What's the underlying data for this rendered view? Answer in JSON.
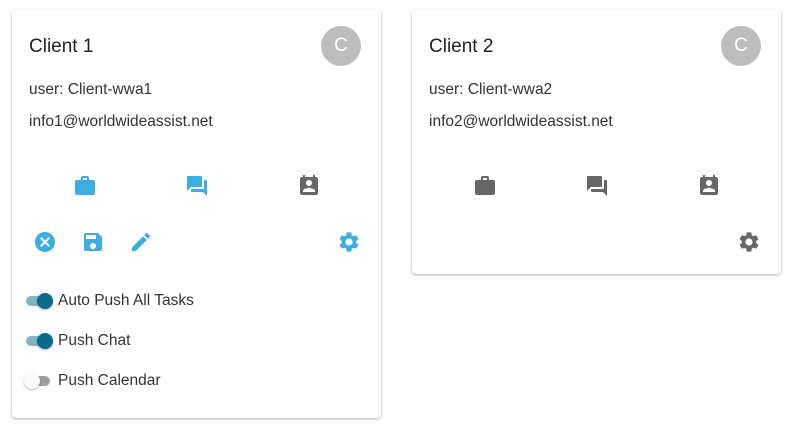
{
  "colors": {
    "accent": "#3daee0",
    "icon_gray": "#666666",
    "switch_on": "#0b6a8a",
    "avatar_bg": "#bdbdbd"
  },
  "cards": [
    {
      "title": "Client 1",
      "avatar_letter": "C",
      "user_line": "user: Client-wwa1",
      "email": "info1@worldwideassist.net",
      "nav_icons": [
        "briefcase-icon",
        "chat-icon",
        "contact-calendar-icon"
      ],
      "actions": [
        "cancel-icon",
        "save-icon",
        "edit-icon",
        "settings-icon"
      ],
      "toggles": [
        {
          "label": "Auto Push All Tasks",
          "on": true
        },
        {
          "label": "Push Chat",
          "on": true
        },
        {
          "label": "Push Calendar",
          "on": false
        }
      ]
    },
    {
      "title": "Client 2",
      "avatar_letter": "C",
      "user_line": "user: Client-wwa2",
      "email": "info2@worldwideassist.net",
      "nav_icons": [
        "briefcase-icon",
        "chat-icon",
        "contact-calendar-icon"
      ],
      "actions": [
        "settings-icon"
      ]
    }
  ]
}
